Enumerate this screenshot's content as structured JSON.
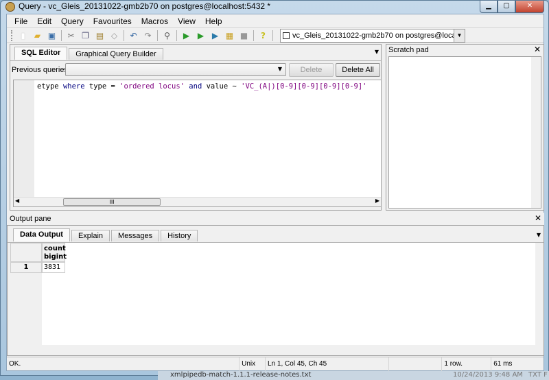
{
  "window": {
    "title": "Query - vc_Gleis_20131022-gmb2b70 on postgres@localhost:5432 *"
  },
  "menu": [
    "File",
    "Edit",
    "Query",
    "Favourites",
    "Macros",
    "View",
    "Help"
  ],
  "toolbar": {
    "connection": "vc_Gleis_20131022-gmb2b70 on postgres@localhost:5432"
  },
  "editor": {
    "tabs": [
      "SQL Editor",
      "Graphical Query Builder"
    ],
    "previous_queries_label": "Previous queries",
    "previous_queries_value": "",
    "delete_label": "Delete",
    "delete_all_label": "Delete All",
    "code": {
      "p1": "etype ",
      "k1": "where ",
      "p2": "type = ",
      "s1": "'ordered locus' ",
      "k2": "and ",
      "p3": "value ~ ",
      "s2": "'VC_(A|)[0-9][0-9][0-9][0-9]'"
    },
    "scroll_grip": "III"
  },
  "scratch_pad": {
    "title": "Scratch pad"
  },
  "output": {
    "title": "Output pane",
    "tabs": [
      "Data Output",
      "Explain",
      "Messages",
      "History"
    ],
    "columns": [
      {
        "name": "count",
        "type": "bigint"
      }
    ],
    "rows": [
      {
        "num": "1",
        "values": [
          "3831"
        ]
      }
    ]
  },
  "status": {
    "message": "OK.",
    "eol": "Unix",
    "position": "Ln 1, Col 45, Ch 45",
    "rows": "1 row.",
    "time": "61 ms"
  },
  "background": {
    "file": "xmlpipedb-match-1.1.1-release-notes.txt",
    "date": "10/24/2013 9:48 AM",
    "type": "TXT F"
  }
}
